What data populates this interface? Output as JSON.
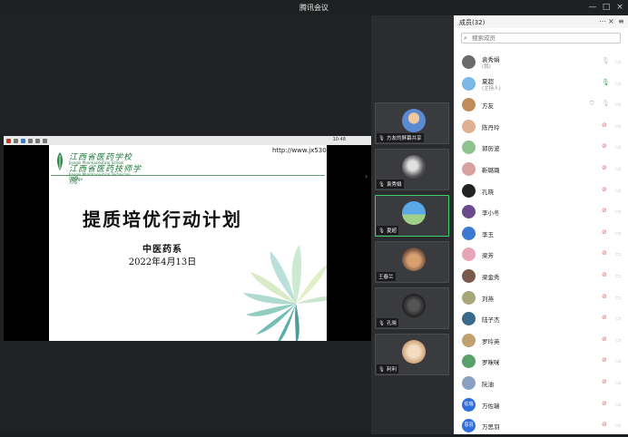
{
  "window": {
    "title": "腾讯会议",
    "controls": [
      "—",
      "□",
      "×"
    ]
  },
  "share": {
    "school_name_1": "江西省医药学校",
    "school_name_1_en": "Jiangxi Pharmaceutical School",
    "school_name_2": "江西省医药技师学院",
    "school_name_2_en": "Jiangxi Pharmaceutical Technician College",
    "url": "http://www.jx530.",
    "slide_title": "提质培优行动计划",
    "slide_dept": "中医药系",
    "slide_date": "2022年4月13日",
    "time": "10:48"
  },
  "filmstrip": [
    {
      "name": "方友的屏幕共享",
      "avatar": "photo-person",
      "active": false
    },
    {
      "name": "袁秀娟",
      "avatar": "photo-bw",
      "active": false
    },
    {
      "name": "夏超",
      "avatar": "sky",
      "active": true
    },
    {
      "name": "王春兰",
      "avatar": "photo-dog",
      "active": false
    },
    {
      "name": "孔晓",
      "avatar": "dark",
      "active": false
    },
    {
      "name": "利利",
      "avatar": "photo-animal",
      "active": false
    }
  ],
  "panel": {
    "title": "成员(32)",
    "search_placeholder": "搜索成员",
    "members": [
      {
        "name": "袁秀娟",
        "sub": "(我)",
        "avatar_color": "#6b6b6b",
        "mic": "off"
      },
      {
        "name": "夏超",
        "sub": "(主持人)",
        "avatar_color": "#7ab8e8",
        "mic": "on"
      },
      {
        "name": "方友",
        "sub": "",
        "avatar_color": "#c08c5a",
        "mic": "off",
        "shield": true
      },
      {
        "name": "陈丹玲",
        "sub": "",
        "avatar_color": "#e0b090",
        "mic": "muted"
      },
      {
        "name": "郭历波",
        "sub": "",
        "avatar_color": "#8dc38f",
        "mic": "muted"
      },
      {
        "name": "靳璐璐",
        "sub": "",
        "avatar_color": "#d9a0a0",
        "mic": "muted"
      },
      {
        "name": "孔晓",
        "sub": "",
        "avatar_color": "#222222",
        "mic": "muted"
      },
      {
        "name": "李小冬",
        "sub": "",
        "avatar_color": "#6a4a8a",
        "mic": "muted"
      },
      {
        "name": "李玉",
        "sub": "",
        "avatar_color": "#3a7ad0",
        "mic": "muted"
      },
      {
        "name": "梁芳",
        "sub": "",
        "avatar_color": "#e8a5b5",
        "mic": "muted"
      },
      {
        "name": "梁金秀",
        "sub": "",
        "avatar_color": "#7a5a4a",
        "mic": "muted"
      },
      {
        "name": "刘燕",
        "sub": "",
        "avatar_color": "#a7a77a",
        "mic": "muted"
      },
      {
        "name": "陆子杰",
        "sub": "",
        "avatar_color": "#3a6a8a",
        "mic": "muted"
      },
      {
        "name": "罗玲英",
        "sub": "",
        "avatar_color": "#c0a070",
        "mic": "muted"
      },
      {
        "name": "罗咪咪",
        "sub": "",
        "avatar_color": "#5aa06a",
        "mic": "muted"
      },
      {
        "name": "阮油",
        "sub": "",
        "avatar_color": "#8aa0c0",
        "mic": "muted"
      },
      {
        "name": "万佐瑞",
        "sub": "",
        "avatar_text": "佐瑞",
        "avatar_color": "#2f6fe0",
        "mic": "muted"
      },
      {
        "name": "万思羽",
        "sub": "",
        "avatar_text": "思羽",
        "avatar_color": "#2f6fe0",
        "mic": "muted"
      }
    ]
  },
  "colors": {
    "active_border": "#3ccf6a",
    "mic_on": "#39b54a",
    "mic_muted": "#e06060"
  }
}
